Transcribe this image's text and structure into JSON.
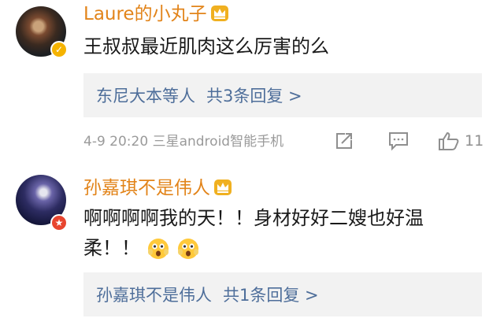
{
  "comments": [
    {
      "username": "Laure的小丸子",
      "badge_icon": "check-icon",
      "text": "王叔叔最近肌肉这么厉害的么",
      "replies_names": "东尼大本等人",
      "replies_count": "共3条回复 >",
      "meta": "4-9 20:20  三星android智能手机",
      "likes": "11"
    },
    {
      "username": "孙嘉琪不是伟人",
      "badge_icon": "star-icon",
      "text": "啊啊啊啊我的天！！身材好好二嫂也好温柔！！",
      "emoji_count": 2,
      "replies_names": "孙嘉琪不是伟人",
      "replies_count": "共1条回复 >"
    }
  ],
  "colors": {
    "username": "#e2841a",
    "link": "#4e6e9a",
    "meta": "#9a9a9a",
    "reply_bg": "#f2f2f2"
  }
}
